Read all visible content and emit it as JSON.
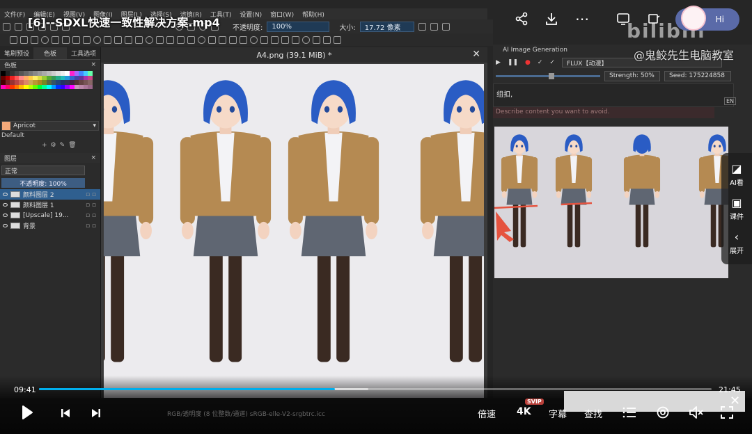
{
  "video": {
    "title": "[6]--SDXL快速一致性解决方案.mp4",
    "watermark": "@鬼鲛先生电脑教室",
    "bili_logo": "bilibili",
    "hi_label": "Hi",
    "time_current": "09:41",
    "time_total": "21:45",
    "progress": 0.44,
    "buffered": 0.49,
    "speed_label": "倍速",
    "quality_label": "4K",
    "quality_badge": "SVIP",
    "subtitle_label": "字幕",
    "search_label": "查找",
    "side_panel": [
      {
        "label": "AI看",
        "icon": "ai-icon"
      },
      {
        "label": "课件",
        "icon": "book-icon"
      },
      {
        "label": "展开",
        "icon": "chevron-left-icon"
      }
    ]
  },
  "krita": {
    "window_title": "A4.png (39.1 MiB) * – Krita",
    "menu": [
      "文件(F)",
      "编辑(E)",
      "视图(V)",
      "图像(I)",
      "图层(L)",
      "选择(S)",
      "滤镜(R)",
      "工具(T)",
      "设置(N)",
      "窗口(W)",
      "帮助(H)"
    ],
    "opacity_label": "不透明度:",
    "opacity_value": "100%",
    "size_label": "大小:",
    "size_value": "17.72 像素",
    "left_tabs": [
      "笔刷预设",
      "色板",
      "工具选项"
    ],
    "palette_title": "色板",
    "color_name": "Apricot",
    "palette_name": "Default",
    "layers_title": "图层",
    "blend_mode": "正常",
    "layer_opacity": "不透明度: 100%",
    "layers": [
      {
        "name": "颜料图层 2",
        "active": true
      },
      {
        "name": "颜料图层 1",
        "active": false
      },
      {
        "name": "[Upscale] 19...",
        "active": false
      },
      {
        "name": "背景",
        "active": false
      }
    ],
    "canvas_title": "A4.png (39.1 MiB) *",
    "status_text": "RGB/透明度 (8 位整数/通道)  sRGB-elle-V2-srgbtrc.icc"
  },
  "ai": {
    "title": "AI Image Generation",
    "model": "FLUX【动漫】",
    "strength": "Strength: 50%",
    "seed": "Seed: 175224858",
    "prompt": "组扣,",
    "negative_placeholder": "Describe content you want to avoid.",
    "en_badge": "EN"
  },
  "colors": {
    "accent": "#00aeec",
    "layer_active": "#2f5f8f",
    "badge": "#b8403a",
    "hair": "#2a5cc4",
    "jacket": "#b58a52",
    "skirt": "#5f6672",
    "tights": "#3a2a22"
  }
}
